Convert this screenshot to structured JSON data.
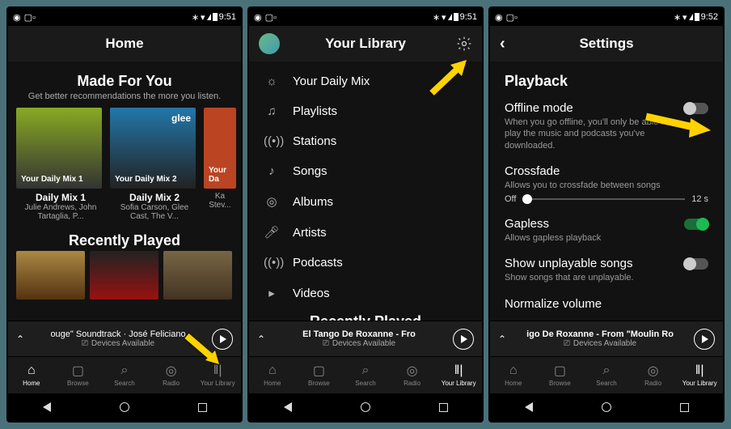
{
  "status": {
    "time": "9:51",
    "time3": "9:52"
  },
  "screen1": {
    "header": "Home",
    "made_title": "Made For You",
    "made_sub": "Get better recommendations the more you listen.",
    "mixes": [
      {
        "cover": "Your Daily Mix 1",
        "title": "Daily Mix 1",
        "sub": "Julie Andrews, John Tartaglia, P..."
      },
      {
        "cover": "Your Daily Mix 2",
        "title": "Daily Mix 2",
        "sub": "Sofia Carson, Glee Cast, The V..."
      },
      {
        "cover": "Your Da",
        "title": "",
        "sub": "Ka\nStev..."
      }
    ],
    "rp_title": "Recently Played",
    "np_song": "ouge\" Soundtrack · José Feliciano",
    "np_devices": "Devices Available"
  },
  "screen2": {
    "header": "Your Library",
    "items": [
      {
        "icon": "sun",
        "label": "Your Daily Mix"
      },
      {
        "icon": "note",
        "label": "Playlists"
      },
      {
        "icon": "antenna",
        "label": "Stations"
      },
      {
        "icon": "song",
        "label": "Songs"
      },
      {
        "icon": "disc",
        "label": "Albums"
      },
      {
        "icon": "mic",
        "label": "Artists"
      },
      {
        "icon": "pod",
        "label": "Podcasts"
      },
      {
        "icon": "video",
        "label": "Videos"
      }
    ],
    "rp_title": "Recently Played",
    "np_song": "El Tango De Roxanne - Fro",
    "np_devices": "Devices Available"
  },
  "screen3": {
    "header": "Settings",
    "category": "Playback",
    "items": [
      {
        "title": "Offline mode",
        "desc": "When you go offline, you'll only be able to play the music and podcasts you've downloaded.",
        "toggle": false
      },
      {
        "title": "Crossfade",
        "desc": "Allows you to crossfade between songs",
        "slider": {
          "left": "Off",
          "right": "12 s"
        }
      },
      {
        "title": "Gapless",
        "desc": "Allows gapless playback",
        "toggle": true
      },
      {
        "title": "Show unplayable songs",
        "desc": "Show songs that are unplayable.",
        "toggle": false
      },
      {
        "title": "Normalize volume",
        "desc": ""
      }
    ],
    "np_song": "igo De Roxanne - From \"Moulin Ro",
    "np_devices": "Devices Available"
  },
  "tabs": [
    {
      "label": "Home"
    },
    {
      "label": "Browse"
    },
    {
      "label": "Search"
    },
    {
      "label": "Radio"
    },
    {
      "label": "Your Library"
    }
  ]
}
